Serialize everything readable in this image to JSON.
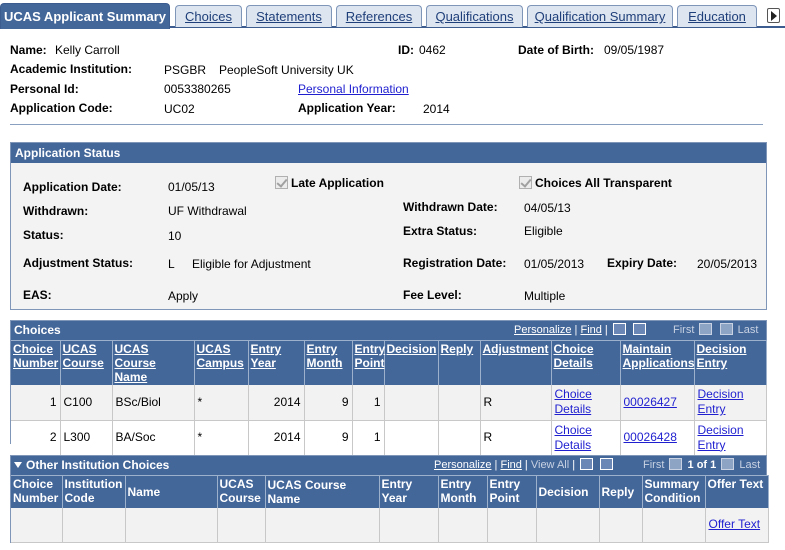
{
  "tabs": [
    {
      "label": "UCAS Applicant Summary",
      "active": true
    },
    {
      "label": "Choices"
    },
    {
      "label": "Statements"
    },
    {
      "label": "References"
    },
    {
      "label": "Qualifications"
    },
    {
      "label": "Qualification Summary"
    },
    {
      "label": "Education"
    }
  ],
  "header": {
    "name_label": "Name:",
    "name": "Kelly Carroll",
    "id_label": "ID:",
    "id": "0462",
    "dob_label": "Date of Birth:",
    "dob": "09/05/1987",
    "institution_label": "Academic Institution:",
    "institution_code": "PSGBR",
    "institution_name": "PeopleSoft University UK",
    "personal_id_label": "Personal Id:",
    "personal_id": "0053380265",
    "personal_info_link": "Personal Information",
    "app_code_label": "Application Code:",
    "app_code": "UC02",
    "app_year_label": "Application Year:",
    "app_year": "2014"
  },
  "status": {
    "title": "Application Status",
    "app_date_label": "Application Date:",
    "app_date": "01/05/13",
    "late_app_label": "Late Application",
    "late_app_checked": true,
    "choices_transparent_label": "Choices All Transparent",
    "choices_transparent_checked": true,
    "withdrawn_label": "Withdrawn:",
    "withdrawn": "UF Withdrawal",
    "withdrawn_date_label": "Withdrawn Date:",
    "withdrawn_date": "04/05/13",
    "status_label": "Status:",
    "status": "10",
    "extra_status_label": "Extra Status:",
    "extra_status": "Eligible",
    "adjustment_label": "Adjustment Status:",
    "adjustment_code": "L",
    "adjustment_desc": "Eligible for Adjustment",
    "registration_label": "Registration Date:",
    "registration_date": "01/05/2013",
    "expiry_label": "Expiry Date:",
    "expiry_date": "20/05/2013",
    "eas_label": "EAS:",
    "eas": "Apply",
    "fee_label": "Fee Level:",
    "fee": "Multiple"
  },
  "choices": {
    "title": "Choices",
    "personalize": "Personalize",
    "find": "Find",
    "first": "First",
    "last": "Last",
    "columns": [
      "Choice Number",
      "UCAS Course",
      "UCAS Course Name",
      "UCAS Campus",
      "Entry Year",
      "Entry Month",
      "Entry Point",
      "Decision",
      "Reply",
      "Adjustment",
      "Choice Details",
      "Maintain Applications",
      "Decision Entry"
    ],
    "rows": [
      {
        "number": "1",
        "course": "C100",
        "course_name": "BSc/Biol",
        "campus": "*",
        "entry_year": "2014",
        "entry_month": "9",
        "entry_point": "1",
        "decision": "",
        "reply": "",
        "adjustment": "R",
        "details_link": "Choice Details",
        "maintain_link": "00026427",
        "decision_link": "Decision Entry"
      },
      {
        "number": "2",
        "course": "L300",
        "course_name": "BA/Soc",
        "campus": "*",
        "entry_year": "2014",
        "entry_month": "9",
        "entry_point": "1",
        "decision": "",
        "reply": "",
        "adjustment": "R",
        "details_link": "Choice Details",
        "maintain_link": "00026428",
        "decision_link": "Decision Entry"
      }
    ]
  },
  "other": {
    "title": "Other Institution Choices",
    "personalize": "Personalize",
    "find": "Find",
    "view_all": "View All",
    "first": "First",
    "count": "1 of 1",
    "last": "Last",
    "columns": [
      "Choice Number",
      "Institution Code",
      "Name",
      "UCAS Course",
      "UCAS Course Name",
      "Entry Year",
      "Entry Month",
      "Entry Point",
      "Decision",
      "Reply",
      "Summary Condition",
      "Offer Text"
    ],
    "offer_link": "Offer Text"
  }
}
